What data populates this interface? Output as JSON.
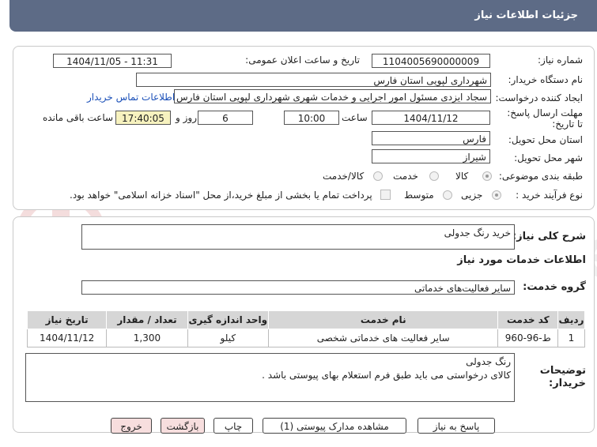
{
  "header": {
    "title": "جزئیات اطلاعات نیاز"
  },
  "fields": {
    "need_number_label": "شماره نیاز:",
    "need_number": "1104005690000009",
    "announce_label": "تاریخ و ساعت اعلان عمومی:",
    "announce_value": "1404/11/05 - 11:31",
    "buyer_org_label": "نام دستگاه خریدار:",
    "buyer_org": "شهرداری لپویی استان فارس",
    "creator_label": "ایجاد کننده درخواست:",
    "creator": "سجاد ایزدی مسئول امور اجرایی و خدمات شهری شهرداری لپویی استان فارس",
    "contact_link": "اطلاعات تماس خریدار",
    "deadline_label": "مهلت ارسال پاسخ: تا تاریخ:",
    "deadline_date": "1404/11/12",
    "time_label": "ساعت",
    "deadline_time": "10:00",
    "days_value": "6",
    "days_label": "روز و",
    "remaining_time": "17:40:05",
    "remaining_label": "ساعت باقی مانده",
    "province_label": "استان محل تحویل:",
    "province": "فارس",
    "city_label": "شهر محل تحویل:",
    "city": "شیراز",
    "category_label": "طبقه بندی موضوعی:",
    "category_options": [
      "کالا",
      "خدمت",
      "کالا/خدمت"
    ],
    "process_label": "نوع فرآیند خرید :",
    "process_options": [
      "جزیی",
      "متوسط"
    ],
    "payment_note": "پرداخت تمام یا بخشی از مبلغ خرید،از محل \"اسناد خزانه اسلامی\" خواهد بود."
  },
  "summary": {
    "label": "شرح کلی نیاز:",
    "value": "خرید رنگ جدولی"
  },
  "services": {
    "title": "اطلاعات خدمات مورد نیاز",
    "group_label": "گروه خدمت:",
    "group_value": "سایر فعالیت‌های خدماتی"
  },
  "table": {
    "headers": [
      "ردیف",
      "کد خدمت",
      "نام خدمت",
      "واحد اندازه گیری",
      "تعداد / مقدار",
      "تاریخ نیاز"
    ],
    "rows": [
      [
        "1",
        "ط-96-960",
        "سایر فعالیت های خدماتی شخصی",
        "کیلو",
        "1,300",
        "1404/11/12"
      ]
    ]
  },
  "notes": {
    "label": "توضیحات خریدار:",
    "line1": "رنگ جدولی",
    "line2": "کالای درخواستی می باید طبق فرم استعلام بهای پیوستی باشد ."
  },
  "buttons": {
    "reply": "پاسخ به نیاز",
    "attachments": "مشاهده مدارک پیوستی (1)",
    "print": "چاپ",
    "back": "بازگشت",
    "exit": "خروج"
  },
  "colors": {
    "header": "#5d6b86",
    "highlight": "#f7f2bf",
    "link": "#1a4fb8",
    "button_pink": "#f7dede"
  }
}
